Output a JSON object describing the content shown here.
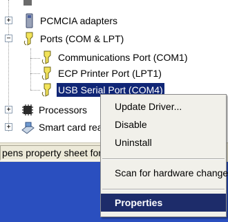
{
  "tree": {
    "items": [
      {
        "label": "PCMCIA adapters",
        "expander": "+"
      },
      {
        "label": "Ports (COM & LPT)",
        "expander": "−"
      },
      {
        "label": "Communications Port (COM1)"
      },
      {
        "label": "ECP Printer Port (LPT1)"
      },
      {
        "label": "USB Serial Port (COM4)"
      },
      {
        "label": "Processors",
        "expander": "+"
      },
      {
        "label": "Smart card reade",
        "expander": "+"
      }
    ]
  },
  "statusbar": {
    "text": "pens property sheet for the"
  },
  "context_menu": {
    "items": [
      {
        "label": "Update Driver..."
      },
      {
        "label": "Disable"
      },
      {
        "label": "Uninstall"
      },
      {
        "label": "Scan for hardware changes"
      },
      {
        "label": "Properties"
      }
    ]
  },
  "colors": {
    "selection": "#102676",
    "menu_highlight": "#1d2c6a",
    "desktop": "#2a4fbf"
  }
}
